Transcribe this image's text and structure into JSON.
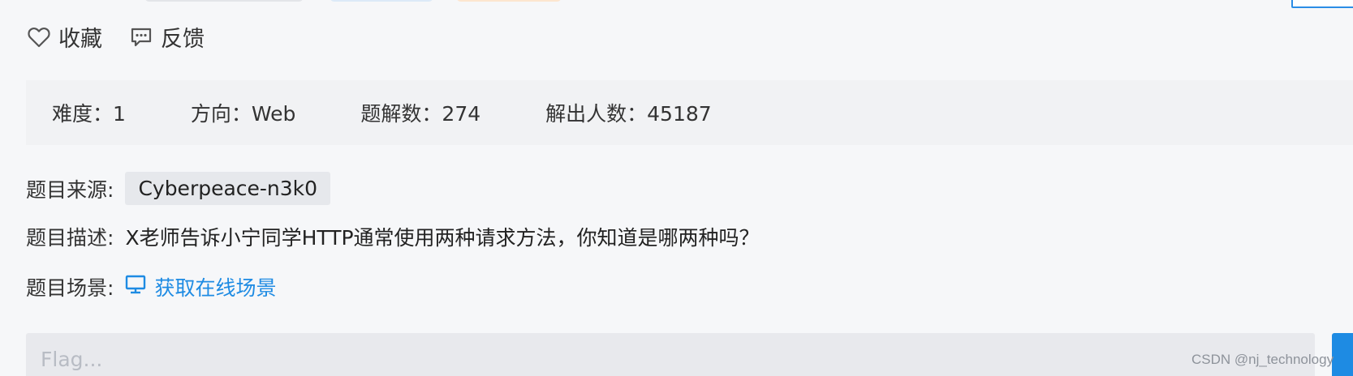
{
  "actions": {
    "favorite_label": "收藏",
    "feedback_label": "反馈"
  },
  "stats": {
    "difficulty": "难度：1",
    "direction": "方向：Web",
    "solves": "题解数：274",
    "solvers": "解出人数：45187"
  },
  "details": {
    "source_label": "题目来源:",
    "source_value": "Cyberpeace-n3k0",
    "description_label": "题目描述:",
    "description_value": "X老师告诉小宁同学HTTP通常使用两种请求方法，你知道是哪两种吗？",
    "scene_label": "题目场景:",
    "scene_link": "获取在线场景"
  },
  "flag": {
    "placeholder": "Flag..."
  },
  "watermark": "CSDN @nj_technology",
  "colors": {
    "accent": "#1e8be3",
    "background": "#f6f7f9",
    "stats_background": "#f1f2f4"
  },
  "icons": {
    "favorite": "heart-outline-icon",
    "feedback": "message-icon",
    "scene": "monitor-icon"
  }
}
